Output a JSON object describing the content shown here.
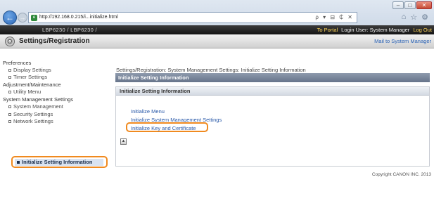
{
  "browser": {
    "url": "http://192.168.0.215/i...initialize.html",
    "address_tools": "ρ ▾ ⊟ ₵ ✕",
    "window_controls": [
      "–",
      "□",
      "✕"
    ],
    "right_icons": [
      "home-icon",
      "star-icon",
      "gear-icon"
    ]
  },
  "header": {
    "model": "LBP6230 / LBP6230 /",
    "portal_link": "To Portal",
    "login_user": "Login User: System Manager",
    "logout_link": "Log Out",
    "title": "Settings/Registration",
    "mail_link": "Mail to System Manager"
  },
  "sidebar": {
    "sections": [
      {
        "label": "Preferences",
        "items": [
          "Display Settings",
          "Timer Settings"
        ]
      },
      {
        "label": "Adjustment/Maintenance",
        "items": [
          "Utility Menu"
        ]
      },
      {
        "label": "System Management Settings",
        "items": [
          "System Management",
          "Security Settings",
          "Network Settings"
        ]
      }
    ],
    "selected": "Initialize Setting Information"
  },
  "main": {
    "breadcrumb": "Settings/Registration: System Management Settings: Initialize Setting Information",
    "page_bar": "Initialize Setting Information",
    "panel_title": "Initialize Setting Information",
    "links": [
      "Initialize Menu",
      "Initialize System Management Settings",
      "Initialize Key and Certificate"
    ],
    "top_icon": "▲",
    "copyright": "Copyright CANON INC. 2013"
  },
  "colors": {
    "highlight": "#f08a1f",
    "link": "#2858a8",
    "header_link": "#ffd65a"
  }
}
